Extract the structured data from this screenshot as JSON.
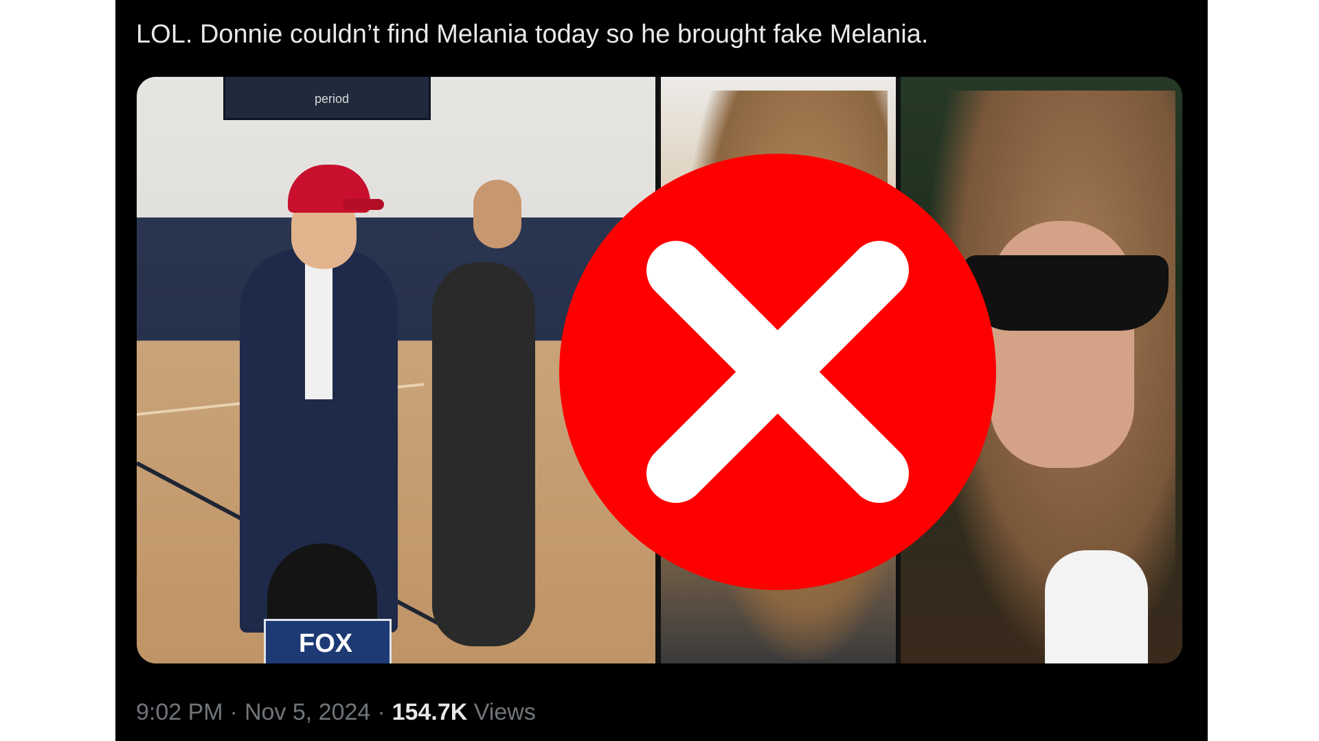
{
  "tweet": {
    "text": "LOL. Donnie couldn’t find Melania today so he brought fake Melania.",
    "time": "9:02 PM",
    "date": "Nov 5, 2024",
    "separator": "·",
    "views_count": "154.7K",
    "views_label": "Views"
  },
  "media": {
    "scoreboard_text": "period",
    "mic_logo": "FOX",
    "overlay_icon": "red-circle-x-icon"
  },
  "colors": {
    "background": "#ffffff",
    "tweet_bg": "#000000",
    "text_primary": "#e7e9ea",
    "text_secondary": "#71767b",
    "reject_red": "#ff0000",
    "cap_red": "#c8102e"
  }
}
